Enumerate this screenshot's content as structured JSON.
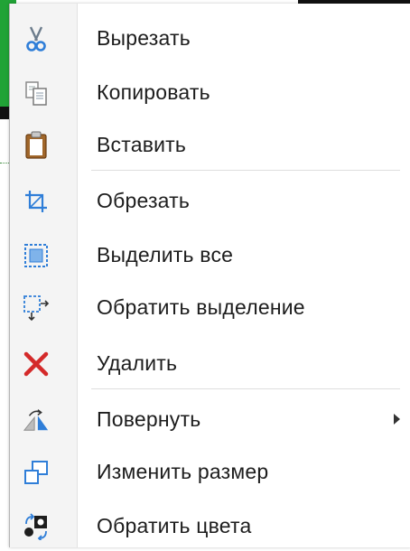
{
  "menu": {
    "items": [
      {
        "label": "Вырезать",
        "icon": "scissors-icon"
      },
      {
        "label": "Копировать",
        "icon": "copy-icon"
      },
      {
        "label": "Вставить",
        "icon": "clipboard-icon"
      },
      {
        "label": "Обрезать",
        "icon": "crop-icon"
      },
      {
        "label": "Выделить все",
        "icon": "select-all-icon"
      },
      {
        "label": "Обратить выделение",
        "icon": "invert-selection-icon"
      },
      {
        "label": "Удалить",
        "icon": "delete-icon"
      },
      {
        "label": "Повернуть",
        "icon": "rotate-icon",
        "submenu": true
      },
      {
        "label": "Изменить размер",
        "icon": "resize-icon"
      },
      {
        "label": "Обратить цвета",
        "icon": "invert-colors-icon"
      }
    ]
  },
  "colors": {
    "menu_bg": "#ffffff",
    "icon_strip": "#f4f4f4",
    "separator": "#dedede",
    "text": "#1d1d1d",
    "accent_blue": "#2f7ed8",
    "delete_red": "#d42a2a",
    "background_green": "#21a336"
  }
}
